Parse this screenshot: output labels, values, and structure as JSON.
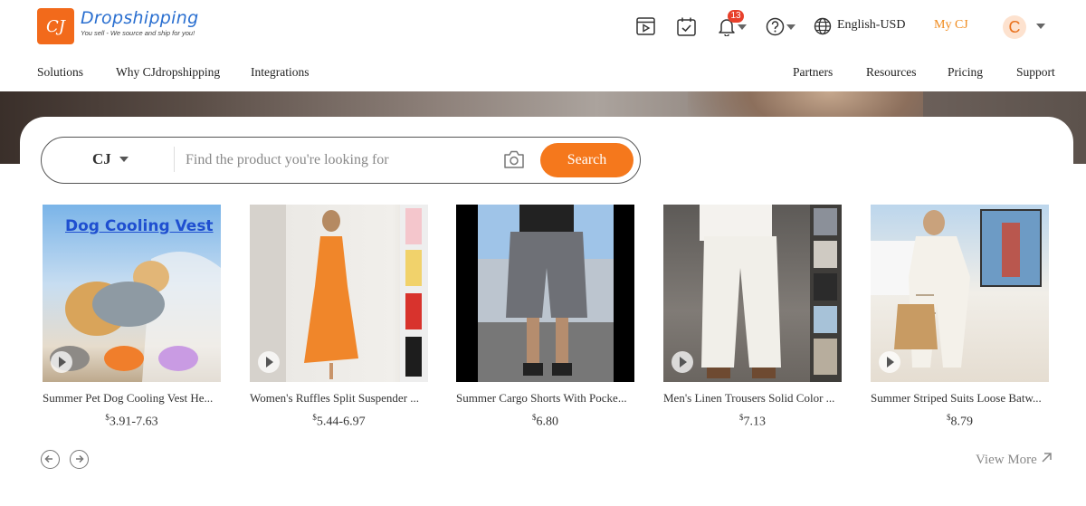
{
  "header": {
    "logo_mark": "CJ",
    "logo_name": "Dropshipping",
    "logo_tagline": "You sell - We source and ship for you!",
    "notification_count": "13",
    "language": "English-USD",
    "my_cj": "My CJ",
    "avatar_letter": "C"
  },
  "nav": {
    "left": [
      "Solutions",
      "Why CJdropshipping",
      "Integrations"
    ],
    "right": [
      "Partners",
      "Resources",
      "Pricing",
      "Support"
    ]
  },
  "search": {
    "scope": "CJ",
    "placeholder": "Find the product you're looking for",
    "button": "Search"
  },
  "products": [
    {
      "title": "Summer Pet Dog Cooling Vest He...",
      "currency": "$",
      "price": "3.91-7.63",
      "image_text": "Dog Cooling Vest"
    },
    {
      "title": "Women's Ruffles Split Suspender ...",
      "currency": "$",
      "price": "5.44-6.97"
    },
    {
      "title": "Summer Cargo Shorts With Pocke...",
      "currency": "$",
      "price": "6.80"
    },
    {
      "title": "Men's Linen Trousers Solid Color ...",
      "currency": "$",
      "price": "7.13"
    },
    {
      "title": "Summer Striped Suits Loose Batw...",
      "currency": "$",
      "price": "8.79"
    }
  ],
  "view_more": "View More",
  "icons": [
    "video-icon",
    "task-check-icon",
    "bell-icon",
    "help-icon",
    "globe-icon",
    "camera-icon",
    "arrow-left-icon",
    "arrow-right-icon",
    "arrow-up-right-icon",
    "play-icon"
  ],
  "colors": {
    "accent": "#f5781c",
    "brand_blue": "#2a6fd0",
    "badge": "#e8402b"
  }
}
